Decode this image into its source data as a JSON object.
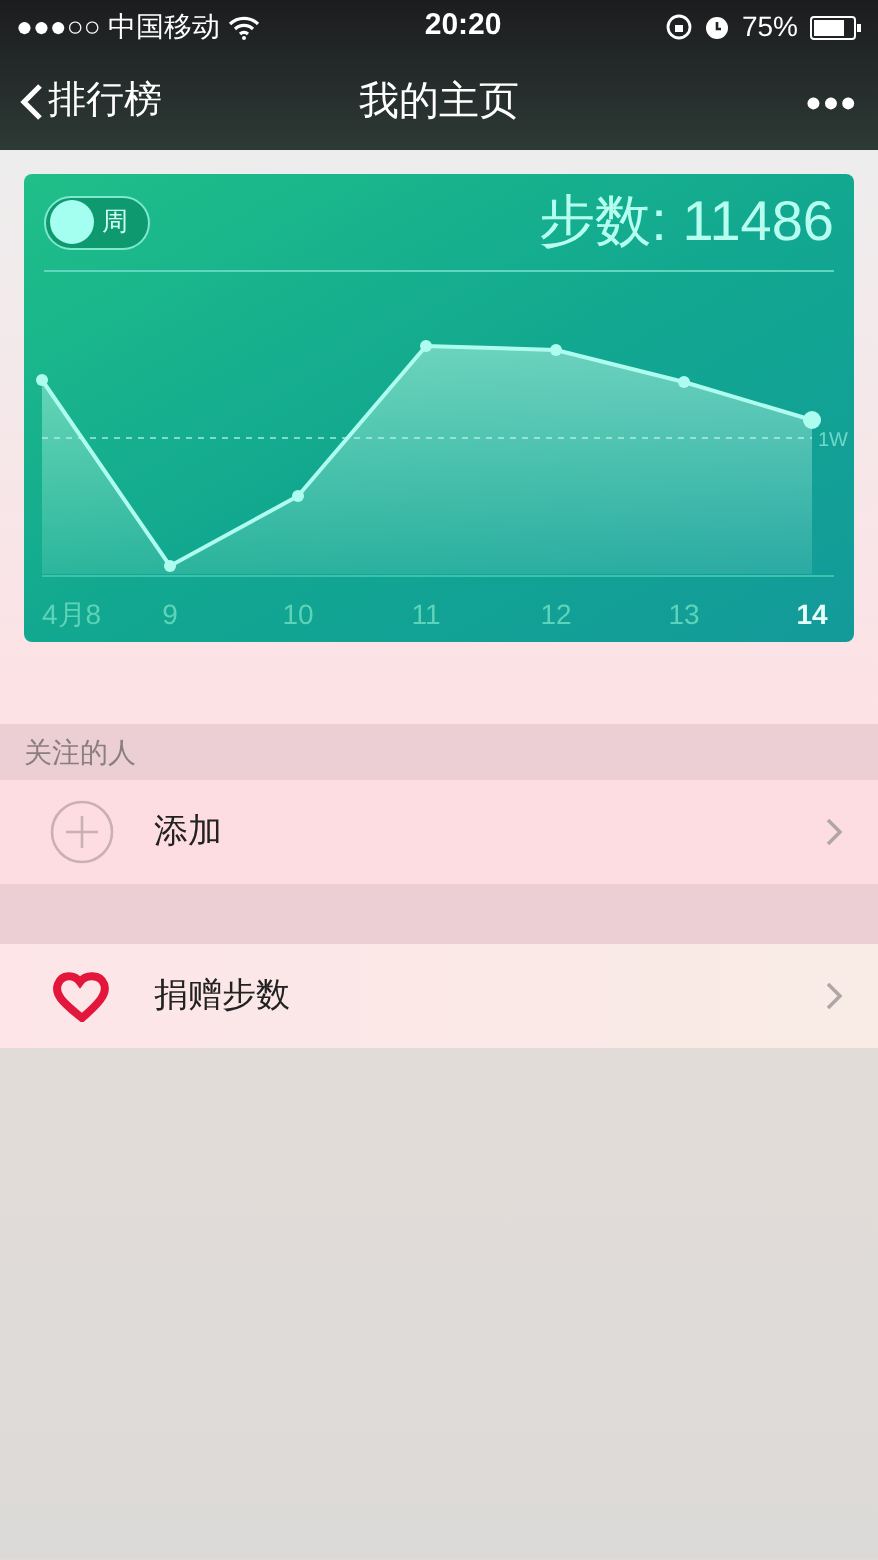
{
  "status_bar": {
    "carrier": "●●●○○ 中国移动",
    "time": "20:20",
    "battery": "75%"
  },
  "nav_bar": {
    "back": "排行榜",
    "title": "我的主页",
    "more": "•••"
  },
  "step_card": {
    "toggle": {
      "label": "周",
      "on": false
    },
    "steps": "步数: 11486",
    "reference_label": "1W",
    "x_labels": [
      {
        "label": "4月8",
        "selected": false
      },
      {
        "label": "9",
        "selected": false
      },
      {
        "label": "10",
        "selected": false
      },
      {
        "label": "11",
        "selected": false
      },
      {
        "label": "12",
        "selected": false
      },
      {
        "label": "13",
        "selected": false
      },
      {
        "label": "14",
        "selected": true
      }
    ]
  },
  "following": {
    "header": "关注的人",
    "items": [
      {
        "kind": "add",
        "label": "添加"
      }
    ]
  },
  "donate": {
    "kind": "donate",
    "label": "捐赠步数"
  }
}
